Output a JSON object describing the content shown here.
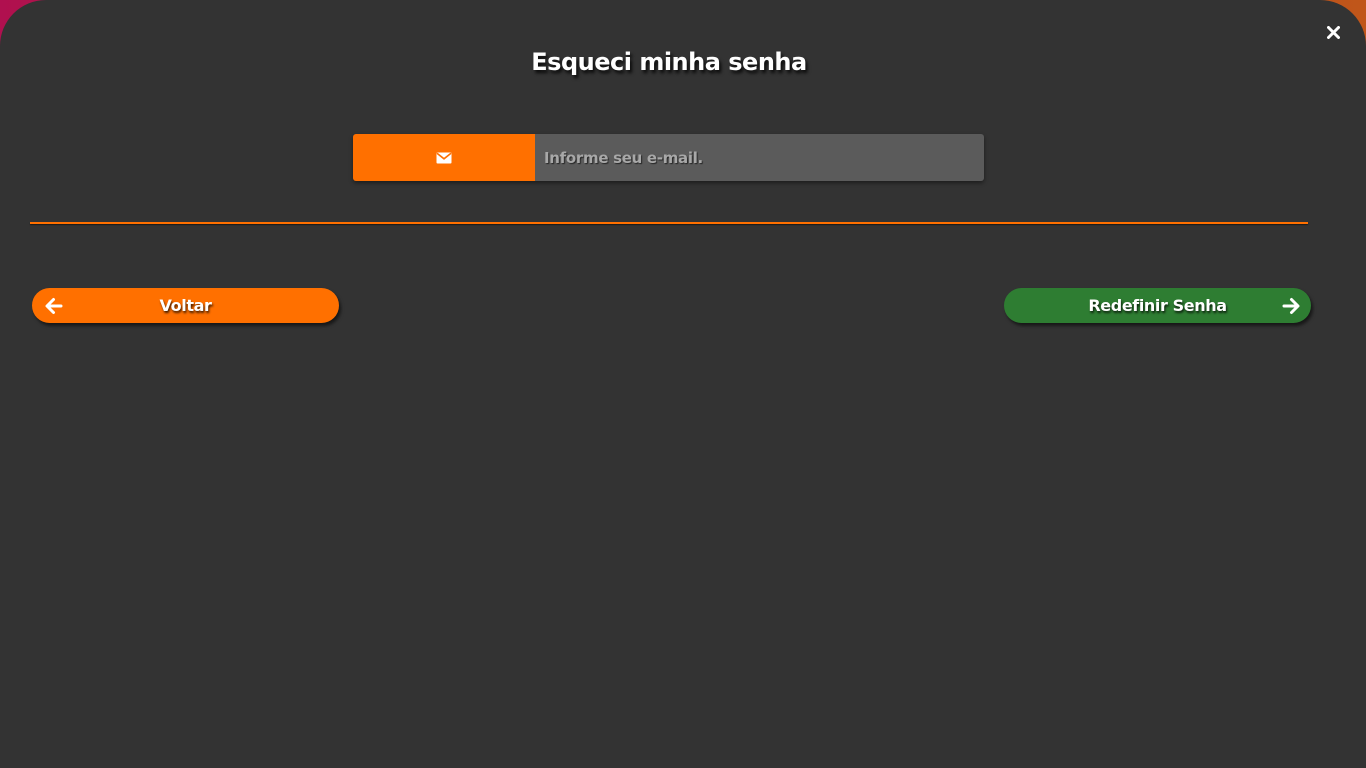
{
  "modal": {
    "title": "Esqueci minha senha",
    "close_icon": "close-icon"
  },
  "email": {
    "icon": "envelope-icon",
    "placeholder": "Informe seu e-mail.",
    "value": ""
  },
  "actions": {
    "back_label": "Voltar",
    "back_icon": "arrow-left-icon",
    "reset_label": "Redefinir Senha",
    "reset_icon": "arrow-right-icon"
  },
  "colors": {
    "background": "#333333",
    "accent": "#ff7000",
    "success": "#2e7d32",
    "input_bg": "#5b5b5b",
    "text": "#ffffff"
  }
}
